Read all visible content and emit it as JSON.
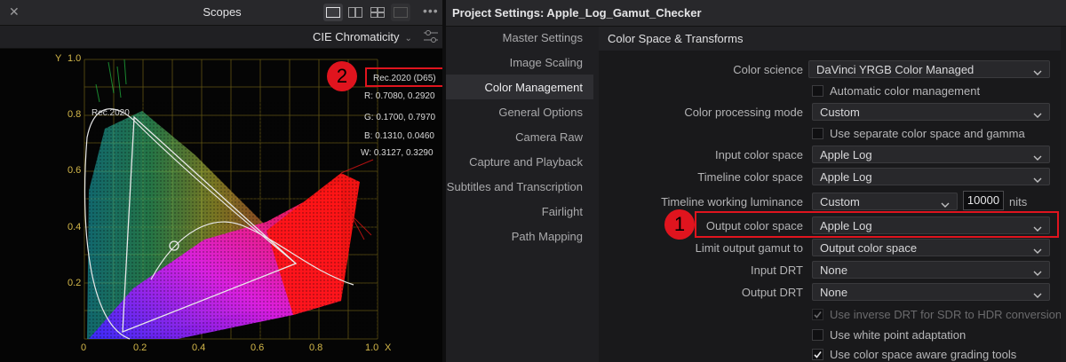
{
  "scopes": {
    "title": "Scopes",
    "scope_type": "CIE Chromaticity",
    "gamut_label": "Rec.2020 (D65)",
    "curve_label": "Rec.2020",
    "primaries": {
      "r": "R: 0.7080, 0.2920",
      "g": "G: 0.1700, 0.7970",
      "b": "B: 0.1310, 0.0460",
      "w": "W: 0.3127, 0.3290"
    },
    "axis": {
      "y_label": "Y",
      "x_label": "X",
      "y_ticks": [
        "1.0",
        "0.8",
        "0.6",
        "0.4",
        "0.2"
      ],
      "x_ticks": [
        "0",
        "0.2",
        "0.4",
        "0.6",
        "0.8",
        "1.0"
      ]
    }
  },
  "settings": {
    "window_title": "Project Settings:  Apple_Log_Gamut_Checker",
    "nav": [
      {
        "label": "Master Settings",
        "active": false
      },
      {
        "label": "Image Scaling",
        "active": false
      },
      {
        "label": "Color Management",
        "active": true
      },
      {
        "label": "General Options",
        "active": false
      },
      {
        "label": "Camera Raw",
        "active": false
      },
      {
        "label": "Capture and Playback",
        "active": false
      },
      {
        "label": "Subtitles and Transcription",
        "active": false
      },
      {
        "label": "Fairlight",
        "active": false
      },
      {
        "label": "Path Mapping",
        "active": false
      }
    ],
    "section_title": "Color Space & Transforms",
    "color_science": {
      "label": "Color science",
      "value": "DaVinci YRGB Color Managed"
    },
    "auto_cm": {
      "label": "Automatic color management",
      "checked": false
    },
    "processing_mode": {
      "label": "Color processing mode",
      "value": "Custom"
    },
    "separate_cs": {
      "label": "Use separate color space and gamma",
      "checked": false
    },
    "input_cs": {
      "label": "Input color space",
      "value": "Apple Log"
    },
    "timeline_cs": {
      "label": "Timeline color space",
      "value": "Apple Log"
    },
    "working_lum": {
      "label": "Timeline working luminance",
      "value": "Custom",
      "nits": "10000",
      "unit": "nits"
    },
    "output_cs": {
      "label": "Output color space",
      "value": "Apple Log"
    },
    "limit_gamut": {
      "label": "Limit output gamut to",
      "value": "Output color space"
    },
    "input_drt": {
      "label": "Input DRT",
      "value": "None"
    },
    "output_drt": {
      "label": "Output DRT",
      "value": "None"
    },
    "inverse_drt": {
      "label": "Use inverse DRT for SDR to HDR conversion",
      "checked": true,
      "disabled": true
    },
    "white_point": {
      "label": "Use white point adaptation",
      "checked": false
    },
    "cs_aware": {
      "label": "Use color space aware grading tools",
      "checked": true
    }
  },
  "annotations": {
    "badge1": "1",
    "badge2": "2"
  },
  "colors": {
    "annotation_red": "#e0141e",
    "accent_grid": "#8b7a22"
  }
}
